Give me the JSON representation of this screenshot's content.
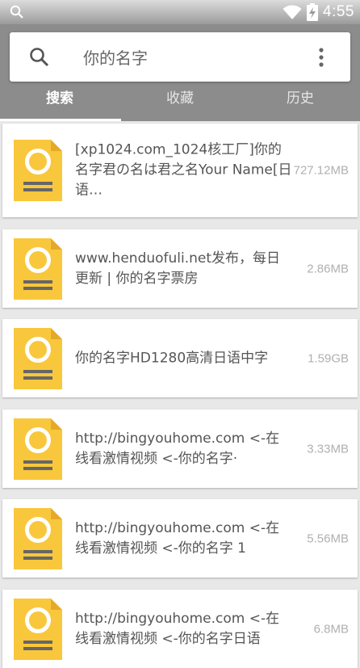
{
  "status_bar": {
    "time": "4:55",
    "icons": [
      "search-icon",
      "wifi-icon",
      "battery-charging-icon"
    ]
  },
  "search": {
    "query": "你的名字"
  },
  "tabs": [
    {
      "label": "搜索",
      "active": true
    },
    {
      "label": "收藏",
      "active": false
    },
    {
      "label": "历史",
      "active": false
    }
  ],
  "colors": {
    "header": "#8c8c8c",
    "file_icon": "#f9c73b",
    "file_icon_fold": "#e5a92a"
  },
  "results": [
    {
      "name": "[xp1024.com_1024核工厂]你的名字君の名は君之名Your Name[日语…",
      "size": "727.12MB"
    },
    {
      "name": "www.henduofuli.net发布，每日更新 | 你的名字票房",
      "size": "2.86MB"
    },
    {
      "name": "你的名字HD1280高清日语中字",
      "size": "1.59GB"
    },
    {
      "name": "http://bingyouhome.com <-在线看激情视频 <-你的名字·",
      "size": "3.33MB"
    },
    {
      "name": "http://bingyouhome.com <-在线看激情视频 <-你的名字 1",
      "size": "5.56MB"
    },
    {
      "name": "http://bingyouhome.com <-在线看激情视频 <-你的名字日语",
      "size": "6.8MB"
    }
  ]
}
